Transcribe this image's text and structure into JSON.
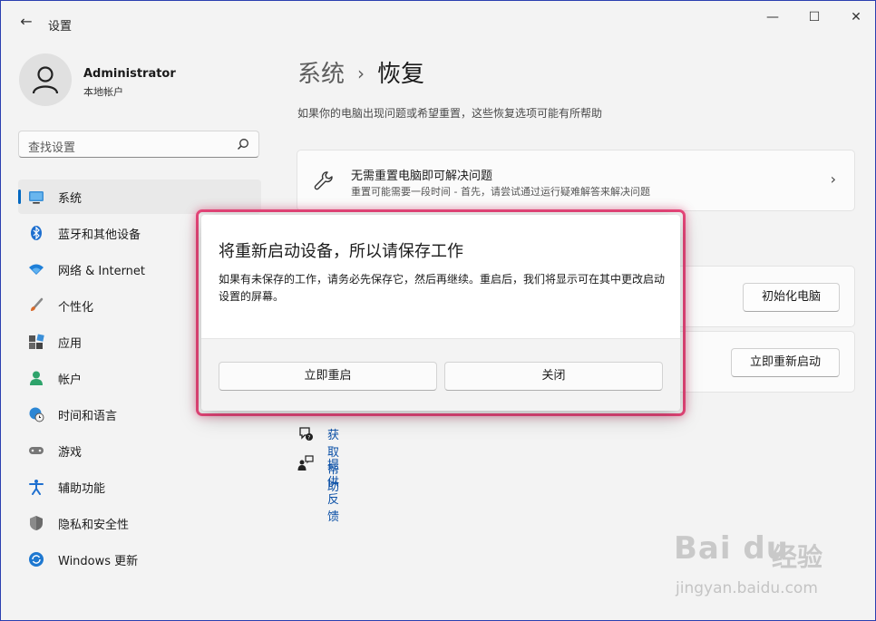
{
  "window": {
    "back_glyph": "←",
    "title": "设置",
    "minimize_glyph": "—",
    "maximize_glyph": "☐",
    "close_glyph": "✕"
  },
  "user": {
    "name": "Administrator",
    "account_type": "本地帐户"
  },
  "search": {
    "placeholder": "查找设置"
  },
  "sidebar": {
    "items": [
      {
        "label": "系统",
        "icon": "monitor-icon",
        "active": true
      },
      {
        "label": "蓝牙和其他设备",
        "icon": "bluetooth-icon"
      },
      {
        "label": "网络 & Internet",
        "icon": "wifi-icon"
      },
      {
        "label": "个性化",
        "icon": "brush-icon"
      },
      {
        "label": "应用",
        "icon": "apps-icon"
      },
      {
        "label": "帐户",
        "icon": "person-icon"
      },
      {
        "label": "时间和语言",
        "icon": "globe-clock-icon"
      },
      {
        "label": "游戏",
        "icon": "gamepad-icon"
      },
      {
        "label": "辅助功能",
        "icon": "accessibility-icon"
      },
      {
        "label": "隐私和安全性",
        "icon": "shield-icon"
      },
      {
        "label": "Windows 更新",
        "icon": "update-icon"
      }
    ]
  },
  "main": {
    "breadcrumb_parent": "系统",
    "breadcrumb_sep": "›",
    "breadcrumb_current": "恢复",
    "subtitle": "如果你的电脑出现问题或希望重置，这些恢复选项可能有所帮助",
    "troubleshoot_card": {
      "title": "无需重置电脑即可解决问题",
      "description": "重置可能需要一段时间 - 首先，请尝试通过运行疑难解答来解决问题",
      "chevron": "›"
    },
    "reset_button": "初始化电脑",
    "restart_button": "立即重新启动",
    "links": [
      {
        "label": "获取帮助",
        "icon": "help-chat-icon"
      },
      {
        "label": "提供反馈",
        "icon": "feedback-icon"
      }
    ]
  },
  "dialog": {
    "title": "将重新启动设备，所以请保存工作",
    "body": "如果有未保存的工作，请务必先保存它，然后再继续。重启后，我们将显示可在其中更改启动设置的屏幕。",
    "primary_button": "立即重启",
    "secondary_button": "关闭"
  },
  "watermark": {
    "logo": "Bai du",
    "cn": "经验",
    "url": "jingyan.baidu.com"
  },
  "colors": {
    "accent": "#0067c0",
    "link": "#0a4fa6",
    "highlight_border": "#e8467a",
    "window_border": "#2a3fb0"
  }
}
